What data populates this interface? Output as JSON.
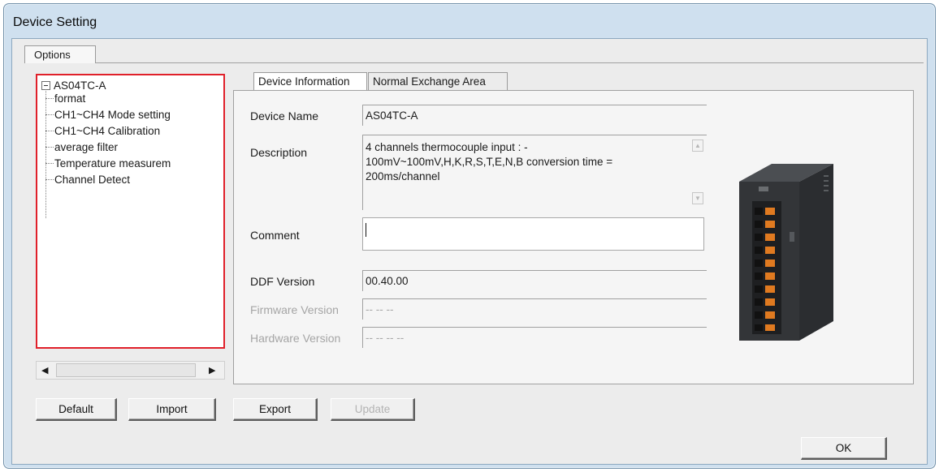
{
  "window": {
    "title": "Device Setting"
  },
  "options_tab": {
    "label": "Options"
  },
  "tree": {
    "root": "AS04TC-A",
    "items": [
      "format",
      "CH1~CH4 Mode setting",
      "CH1~CH4 Calibration",
      "average filter",
      "Temperature measurem",
      "Channel Detect"
    ]
  },
  "tabs": {
    "device_information": "Device Information",
    "normal_exchange": "Normal Exchange Area"
  },
  "info": {
    "device_name_label": "Device Name",
    "device_name_value": "AS04TC-A",
    "description_label": "Description",
    "description_value": "4 channels thermocouple input : -\n100mV~100mV,H,K,R,S,T,E,N,B conversion time =\n200ms/channel",
    "comment_label": "Comment",
    "comment_value": "",
    "ddf_version_label": "DDF Version",
    "ddf_version_value": "00.40.00",
    "firmware_version_label": "Firmware Version",
    "firmware_version_value": "-- -- --",
    "hardware_version_label": "Hardware Version",
    "hardware_version_value": "-- -- -- --"
  },
  "buttons": {
    "default": "Default",
    "import": "Import",
    "export": "Export",
    "update": "Update",
    "ok": "OK"
  },
  "icons": {
    "tree_expander": "collapse-minus-icon",
    "scroll_left": "arrow-left-icon",
    "scroll_right": "arrow-right-icon",
    "scroll_up": "arrow-up-icon",
    "scroll_down": "arrow-down-icon"
  },
  "colors": {
    "selection_outline": "#e0202a",
    "title_bar": "#cfe0ef"
  }
}
